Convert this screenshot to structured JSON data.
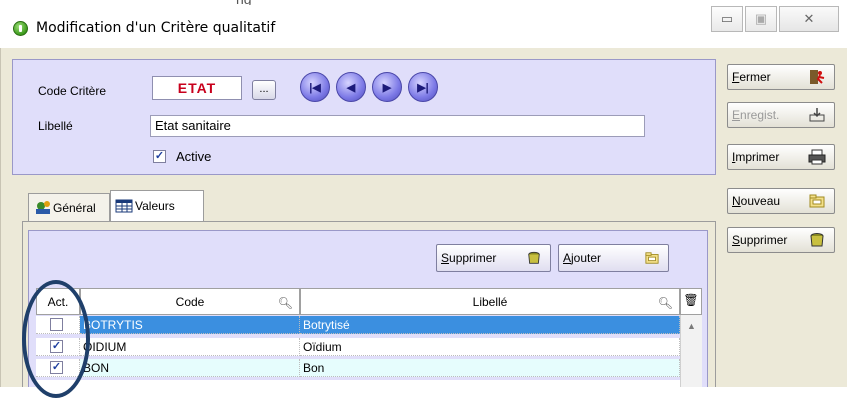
{
  "window": {
    "title": "Modification d'un Critère qualitatif",
    "title_overflow": "ng",
    "minimize": "▭",
    "maximize": "▣",
    "close": "✕"
  },
  "header": {
    "code_label": "Code Critère",
    "code_value": "ETAT",
    "lookup_button": "...",
    "nav_first": "|◀",
    "nav_prev": "◀",
    "nav_next": "▶",
    "nav_last": "▶|",
    "libelle_label": "Libellé",
    "libelle_value": "Etat sanitaire",
    "active_label": "Active",
    "active_checked": true
  },
  "actions": [
    {
      "label_underlined": "F",
      "label_rest": "ermer",
      "icon": "exit-icon",
      "disabled": false
    },
    {
      "label_underlined": "E",
      "label_rest": "nregist.",
      "icon": "save-icon",
      "disabled": true
    },
    {
      "label_underlined": "I",
      "label_rest": "mprimer",
      "icon": "printer-icon",
      "disabled": false
    },
    {
      "label_underlined": "N",
      "label_rest": "ouveau",
      "icon": "new-folder-icon",
      "disabled": false
    },
    {
      "label_underlined": "S",
      "label_rest": "upprimer",
      "icon": "delete-icon",
      "disabled": false
    }
  ],
  "tabs": [
    {
      "label": "Général",
      "icon": "general-icon",
      "active": false
    },
    {
      "label": "Valeurs",
      "icon": "table-icon",
      "active": true
    }
  ],
  "values_panel": {
    "delete_button": {
      "underlined": "S",
      "rest": "upprimer"
    },
    "add_button": {
      "underlined": "A",
      "rest": "jouter"
    },
    "columns": [
      "Act.",
      "Code",
      "Libellé"
    ],
    "rows": [
      {
        "active": false,
        "code": "BOTRYTIS",
        "libelle": "Botrytisé",
        "selected": true
      },
      {
        "active": true,
        "code": "OIDIUM",
        "libelle": "Oïdium",
        "selected": false
      },
      {
        "active": true,
        "code": "BON",
        "libelle": "Bon",
        "selected": false
      }
    ]
  },
  "colors": {
    "panel": "#e0defa",
    "selection": "#3b8fe0",
    "code_text": "#c8001c",
    "annotation": "#1f3f6a"
  }
}
